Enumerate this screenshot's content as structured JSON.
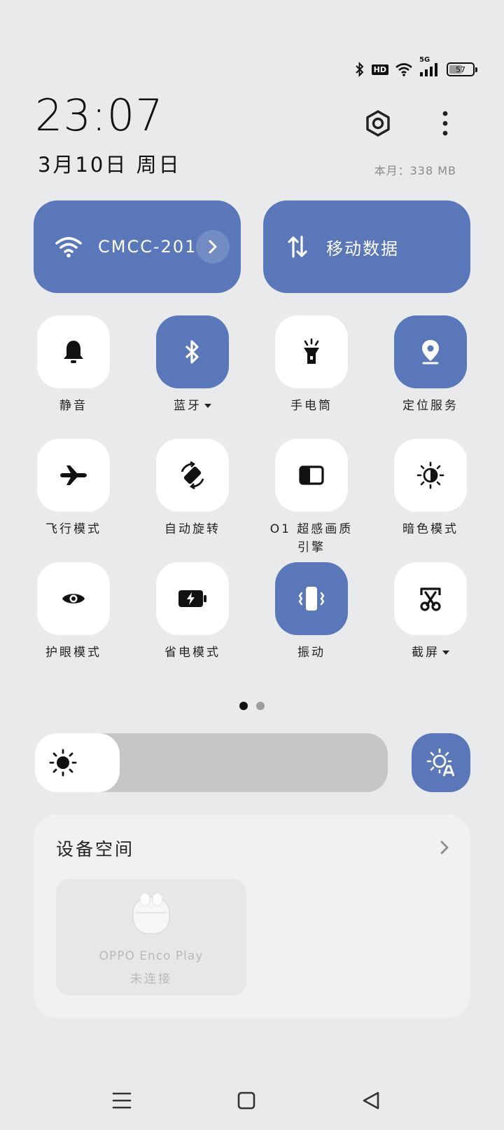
{
  "status_bar": {
    "icons": [
      "bluetooth-icon",
      "hd-icon",
      "wifi-icon",
      "cellular-5g-icon",
      "battery-icon"
    ],
    "hd_label": "HD",
    "network_label": "5G",
    "battery_level": "57"
  },
  "header": {
    "time": "23:07",
    "date": "3月10日 周日",
    "data_usage": "本月：338 MB"
  },
  "wifi_tile": {
    "label": "CMCC-201",
    "icon": "wifi-icon",
    "active": true
  },
  "mobile_data_tile": {
    "label": "移动数据",
    "icon": "data-arrows-icon",
    "active": true
  },
  "toggles": [
    {
      "label": "静音",
      "icon": "bell-icon",
      "active": false,
      "has_menu": false
    },
    {
      "label": "蓝牙",
      "icon": "bluetooth-icon",
      "active": true,
      "has_menu": true
    },
    {
      "label": "手电筒",
      "icon": "flashlight-icon",
      "active": false,
      "has_menu": false
    },
    {
      "label": "定位服务",
      "icon": "location-icon",
      "active": true,
      "has_menu": false
    },
    {
      "label": "飞行模式",
      "icon": "airplane-icon",
      "active": false,
      "has_menu": false
    },
    {
      "label": "自动旋转",
      "icon": "auto-rotate-icon",
      "active": false,
      "has_menu": false
    },
    {
      "label": "O1 超感画质\n引擎",
      "icon": "display-engine-icon",
      "active": false,
      "has_menu": false
    },
    {
      "label": "暗色模式",
      "icon": "dark-mode-icon",
      "active": false,
      "has_menu": false
    },
    {
      "label": "护眼模式",
      "icon": "eye-icon",
      "active": false,
      "has_menu": false
    },
    {
      "label": "省电模式",
      "icon": "battery-saver-icon",
      "active": false,
      "has_menu": false
    },
    {
      "label": "振动",
      "icon": "vibrate-icon",
      "active": true,
      "has_menu": false
    },
    {
      "label": "截屏",
      "icon": "screenshot-icon",
      "active": false,
      "has_menu": true
    }
  ],
  "page_indicator": {
    "pages": 2,
    "current": 1
  },
  "brightness": {
    "level": 0.24,
    "icon": "sun-icon",
    "auto_icon": "auto-brightness-icon"
  },
  "device_space": {
    "title": "设备空间",
    "devices": [
      {
        "name": "OPPO Enco Play",
        "status": "未连接"
      }
    ]
  },
  "nav_bar": {
    "buttons": [
      "menu-icon",
      "home-icon",
      "back-icon"
    ]
  },
  "colors": {
    "accent": "#5a77b9",
    "background": "#e9eaeb",
    "tile_off": "#ffffff"
  }
}
